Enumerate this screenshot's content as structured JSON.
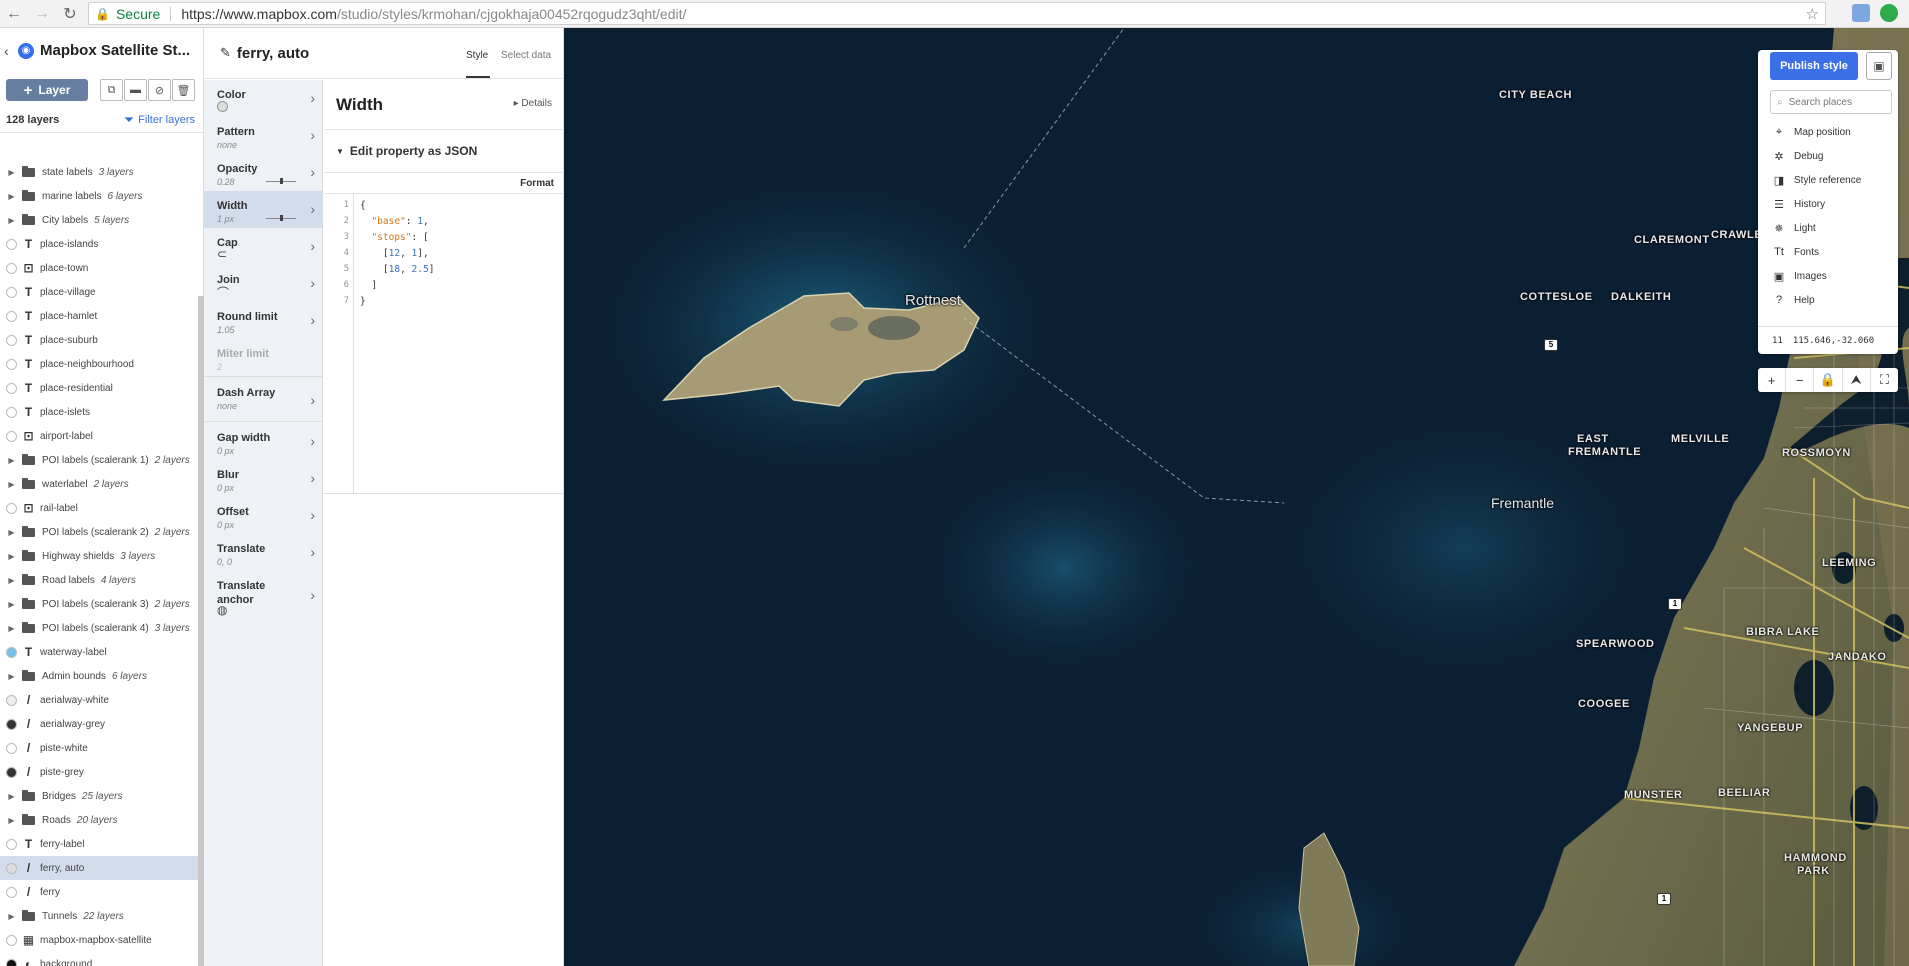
{
  "browser": {
    "secure_label": "Secure",
    "url_host": "https://www.mapbox.com",
    "url_path": "/studio/styles/krmohan/cjgokhaja00452rqogudz3qht/edit/"
  },
  "sidebar": {
    "style_name": "Mapbox Satellite St...",
    "add_layer_label": "Layer",
    "layer_count": "128 layers",
    "filter_label": "Filter layers",
    "layers": [
      {
        "name": "state labels",
        "kind": "group",
        "count": "3 layers"
      },
      {
        "name": "marine labels",
        "kind": "group",
        "count": "6 layers"
      },
      {
        "name": "City labels",
        "kind": "group",
        "count": "5 layers"
      },
      {
        "name": "place-islands",
        "kind": "symbol",
        "dot": "#ffffff"
      },
      {
        "name": "place-town",
        "kind": "symbol-hidden",
        "dot": "#ffffff"
      },
      {
        "name": "place-village",
        "kind": "symbol",
        "dot": "#ffffff"
      },
      {
        "name": "place-hamlet",
        "kind": "symbol",
        "dot": "#ffffff"
      },
      {
        "name": "place-suburb",
        "kind": "symbol",
        "dot": "#ffffff"
      },
      {
        "name": "place-neighbourhood",
        "kind": "symbol",
        "dot": "#ffffff"
      },
      {
        "name": "place-residential",
        "kind": "symbol",
        "dot": "#ffffff"
      },
      {
        "name": "place-islets",
        "kind": "symbol",
        "dot": "#ffffff"
      },
      {
        "name": "airport-label",
        "kind": "symbol-hidden",
        "dot": "#ffffff"
      },
      {
        "name": "POI labels (scalerank 1)",
        "kind": "group",
        "count": "2 layers"
      },
      {
        "name": "waterlabel",
        "kind": "group",
        "count": "2 layers"
      },
      {
        "name": "rail-label",
        "kind": "symbol-hidden",
        "dot": "#ffffff"
      },
      {
        "name": "POI labels (scalerank 2)",
        "kind": "group",
        "count": "2 layers"
      },
      {
        "name": "Highway shields",
        "kind": "group",
        "count": "3 layers"
      },
      {
        "name": "Road labels",
        "kind": "group",
        "count": "4 layers"
      },
      {
        "name": "POI labels (scalerank 3)",
        "kind": "group",
        "count": "2 layers"
      },
      {
        "name": "POI labels (scalerank 4)",
        "kind": "group",
        "count": "3 layers"
      },
      {
        "name": "waterway-label",
        "kind": "symbol",
        "dot": "#74c2e8"
      },
      {
        "name": "Admin bounds",
        "kind": "group",
        "count": "6 layers"
      },
      {
        "name": "aerialway-white",
        "kind": "line",
        "dot": "#eeeeee"
      },
      {
        "name": "aerialway-grey",
        "kind": "line",
        "dot": "#333333"
      },
      {
        "name": "piste-white",
        "kind": "line",
        "dot": "#ffffff"
      },
      {
        "name": "piste-grey",
        "kind": "line",
        "dot": "#333333"
      },
      {
        "name": "Bridges",
        "kind": "group",
        "count": "25 layers"
      },
      {
        "name": "Roads",
        "kind": "group",
        "count": "20 layers"
      },
      {
        "name": "ferry-label",
        "kind": "symbol",
        "dot": "#ffffff"
      },
      {
        "name": "ferry, auto",
        "kind": "line",
        "dot": "#dddddd",
        "selected": true
      },
      {
        "name": "ferry",
        "kind": "line",
        "dot": "#ffffff"
      },
      {
        "name": "Tunnels",
        "kind": "group",
        "count": "22 layers"
      },
      {
        "name": "mapbox-mapbox-satellite",
        "kind": "raster",
        "dot": "#ffffff"
      },
      {
        "name": "background",
        "kind": "background",
        "dot": "#111111"
      }
    ]
  },
  "panel": {
    "layer_title": "ferry, auto",
    "tab_style": "Style",
    "tab_select": "Select data",
    "properties": [
      {
        "name": "Color",
        "value": "",
        "display": "swatch"
      },
      {
        "name": "Pattern",
        "value": "none"
      },
      {
        "name": "Opacity",
        "value": "0.28",
        "display": "slider"
      },
      {
        "name": "Width",
        "value": "1 px",
        "display": "slider",
        "selected": true
      },
      {
        "name": "Cap",
        "value": "",
        "display": "glyph",
        "glyph": "⊂"
      },
      {
        "name": "Join",
        "value": "",
        "display": "glyph",
        "glyph": "⌒"
      },
      {
        "name": "Round limit",
        "value": "1.05"
      },
      {
        "name": "Miter limit",
        "value": "2",
        "disabled": true
      },
      {
        "name": "Dash Array",
        "value": "none"
      },
      {
        "name": "Gap width",
        "value": "0 px"
      },
      {
        "name": "Blur",
        "value": "0 px"
      },
      {
        "name": "Offset",
        "value": "0 px"
      },
      {
        "name": "Translate",
        "value": "0, 0"
      },
      {
        "name": "Translate anchor",
        "value": "",
        "display": "glyph",
        "glyph": "◍"
      }
    ],
    "editor": {
      "title": "Width",
      "details_label": "Details",
      "json_toggle": "Edit property as JSON",
      "format_label": "Format",
      "line_numbers": [
        "1",
        "2",
        "3",
        "4",
        "5",
        "6",
        "7"
      ]
    }
  },
  "map": {
    "labels": {
      "rottnest": "Rottnest",
      "fremantle": "Fremantle",
      "city_beach": "CITY BEACH",
      "claremont": "CLAREMONT",
      "crawley": "CRAWLE",
      "cottesloe": "COTTESLOE",
      "dalkeith": "DALKEITH",
      "east_fremantle_1": "EAST",
      "east_fremantle_2": "FREMANTLE",
      "melville": "MELVILLE",
      "rossmoyne": "ROSSMOYN",
      "leeming": "LEEMING",
      "spearwood": "SPEARWOOD",
      "bibra_lake": "BIBRA LAKE",
      "jandakot": "JANDAKO",
      "coogee": "COOGEE",
      "yangebup": "YANGEBUP",
      "munster": "MUNSTER",
      "beeliar": "BEELIAR",
      "hammond_park_1": "HAMMOND",
      "hammond_park_2": "PARK"
    },
    "shields": {
      "s5": "5",
      "s1a": "1",
      "s1b": "1"
    },
    "publish_label": "Publish style",
    "search_placeholder": "Search places",
    "tools": [
      {
        "label": "Map position",
        "icon": "map-position-icon"
      },
      {
        "label": "Debug",
        "icon": "bug-icon"
      },
      {
        "label": "Style reference",
        "icon": "book-icon"
      },
      {
        "label": "History",
        "icon": "history-icon"
      },
      {
        "label": "Light",
        "icon": "light-icon"
      },
      {
        "label": "Fonts",
        "icon": "fonts-icon"
      },
      {
        "label": "Images",
        "icon": "images-icon"
      },
      {
        "label": "Help",
        "icon": "help-icon"
      }
    ],
    "zoom_level": "11",
    "coordinates": "115.646,-32.060"
  }
}
